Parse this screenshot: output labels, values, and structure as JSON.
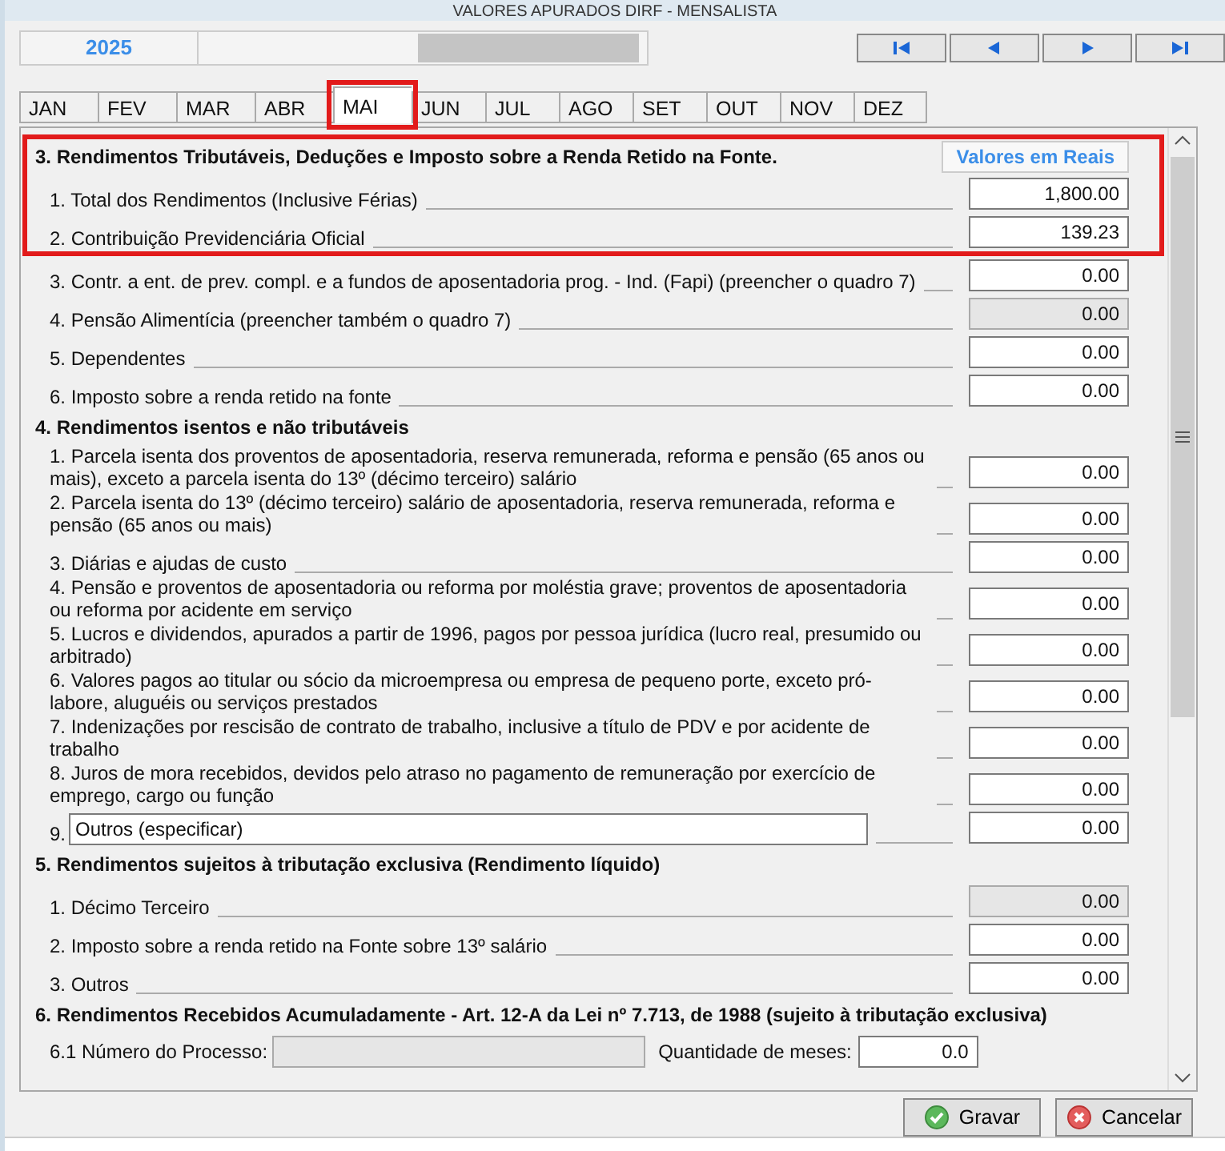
{
  "window": {
    "title": "VALORES APURADOS DIRF - MENSALISTA"
  },
  "year": "2025",
  "nav_buttons": [
    {
      "kind": "first"
    },
    {
      "kind": "prev"
    },
    {
      "kind": "next"
    },
    {
      "kind": "last"
    }
  ],
  "tabs": [
    {
      "label": "JAN",
      "selected": false,
      "highlighted": false
    },
    {
      "label": "FEV",
      "selected": false,
      "highlighted": false
    },
    {
      "label": "MAR",
      "selected": false,
      "highlighted": false
    },
    {
      "label": "ABR",
      "selected": false,
      "highlighted": false
    },
    {
      "label": "MAI",
      "selected": true,
      "highlighted": true
    },
    {
      "label": "JUN",
      "selected": false,
      "highlighted": false
    },
    {
      "label": "JUL",
      "selected": false,
      "highlighted": false
    },
    {
      "label": "AGO",
      "selected": false,
      "highlighted": false
    },
    {
      "label": "SET",
      "selected": false,
      "highlighted": false
    },
    {
      "label": "OUT",
      "selected": false,
      "highlighted": false
    },
    {
      "label": "NOV",
      "selected": false,
      "highlighted": false
    },
    {
      "label": "DEZ",
      "selected": false,
      "highlighted": false
    }
  ],
  "column_header": "Valores em Reais",
  "sections": [
    {
      "title": "3. Rendimentos Tributáveis, Deduções e Imposto sobre a Renda Retido na Fonte.",
      "rows": [
        {
          "kind": "value",
          "label": "1. Total dos Rendimentos (Inclusive Férias)",
          "value": "1,800.00",
          "disabled": false,
          "highlighted": true
        },
        {
          "kind": "value",
          "label": "2. Contribuição Previdenciária Oficial",
          "value": "139.23",
          "disabled": false,
          "highlighted": true
        },
        {
          "kind": "value",
          "label": "3. Contr. a ent. de prev. compl. e a fundos de aposentadoria prog. - Ind. (Fapi) (preencher o quadro 7)",
          "value": "0.00",
          "disabled": false,
          "highlighted": false
        },
        {
          "kind": "value",
          "label": "4. Pensão Alimentícia  (preencher também o quadro 7)",
          "value": "0.00",
          "disabled": true,
          "highlighted": false
        },
        {
          "kind": "value",
          "label": "5. Dependentes",
          "value": "0.00",
          "disabled": false,
          "highlighted": false
        },
        {
          "kind": "value",
          "label": "6. Imposto sobre a renda retido na fonte",
          "value": "0.00",
          "disabled": false,
          "highlighted": false
        }
      ]
    },
    {
      "title": "4. Rendimentos isentos e não tributáveis",
      "rows": [
        {
          "kind": "value",
          "label": "1. Parcela isenta dos proventos de aposentadoria, reserva remunerada, reforma e pensão (65 anos ou mais), exceto a parcela isenta do 13º (décimo terceiro) salário",
          "value": "0.00",
          "disabled": false,
          "highlighted": false
        },
        {
          "kind": "value",
          "label": "2. Parcela isenta do 13º (décimo terceiro) salário de aposentadoria, reserva remunerada, reforma e pensão (65 anos ou mais)",
          "value": "0.00",
          "disabled": false,
          "highlighted": false
        },
        {
          "kind": "value",
          "label": "3. Diárias e ajudas de custo",
          "value": "0.00",
          "disabled": false,
          "highlighted": false
        },
        {
          "kind": "value",
          "label": "4. Pensão e proventos de aposentadoria ou reforma por moléstia grave; proventos de aposentadoria ou reforma por acidente em serviço",
          "value": "0.00",
          "disabled": false,
          "highlighted": false
        },
        {
          "kind": "value",
          "label": "5. Lucros e dividendos, apurados a partir de 1996, pagos por pessoa jurídica (lucro real, presumido ou arbitrado)",
          "value": "0.00",
          "disabled": false,
          "highlighted": false
        },
        {
          "kind": "value",
          "label": "6. Valores pagos ao titular ou sócio da microempresa ou empresa de pequeno porte, exceto pró-labore, aluguéis ou serviços prestados",
          "value": "0.00",
          "disabled": false,
          "highlighted": false
        },
        {
          "kind": "value",
          "label": "7. Indenizações por rescisão de contrato de trabalho, inclusive a título de PDV e por acidente de trabalho",
          "value": "0.00",
          "disabled": false,
          "highlighted": false
        },
        {
          "kind": "value",
          "label": "8. Juros de mora recebidos, devidos pelo atraso no pagamento de remuneração por exercício de emprego, cargo ou função",
          "value": "0.00",
          "disabled": false,
          "highlighted": false
        },
        {
          "kind": "specify",
          "label": "9.",
          "text": "Outros (especificar)",
          "value": "0.00",
          "disabled": false,
          "highlighted": false
        }
      ]
    },
    {
      "title": "5. Rendimentos sujeitos à tributação exclusiva (Rendimento líquido)",
      "rows": [
        {
          "kind": "value",
          "label": "1. Décimo Terceiro",
          "value": "0.00",
          "disabled": true,
          "highlighted": false
        },
        {
          "kind": "value",
          "label": "2. Imposto sobre a renda retido na Fonte sobre 13º salário",
          "value": "0.00",
          "disabled": false,
          "highlighted": false
        },
        {
          "kind": "value",
          "label": "3. Outros",
          "value": "0.00",
          "disabled": false,
          "highlighted": false
        }
      ]
    },
    {
      "title": "6. Rendimentos Recebidos Acumuladamente - Art. 12-A da Lei nº 7.713, de 1988 (sujeito à tributação exclusiva)",
      "rows": [
        {
          "kind": "process",
          "label": "6.1 Número do Processo:",
          "disabled": true,
          "months_label": "Quantidade de meses:",
          "value": "0.0",
          "highlighted": false
        }
      ]
    }
  ],
  "buttons": [
    {
      "kind": "save",
      "label": "Gravar"
    },
    {
      "kind": "cancel",
      "label": "Cancelar"
    }
  ]
}
